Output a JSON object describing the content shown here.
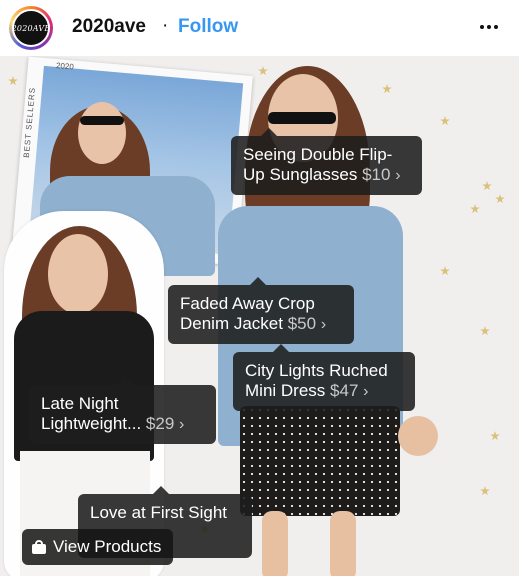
{
  "header": {
    "avatar_text": "2020AVE",
    "username": "2020ave",
    "separator": "·",
    "follow_label": "Follow",
    "more_icon": "more-horizontal-icon"
  },
  "photo": {
    "polaroid_side_text": "BEST SELLERS",
    "polaroid_year": "2020"
  },
  "tags": [
    {
      "name_line1": "Seeing Double Flip-",
      "name_line2": "Up Sunglasses",
      "price": "$10",
      "chevron": "›"
    },
    {
      "name_line1": "Faded Away Crop",
      "name_line2": "Denim Jacket",
      "price": "$50",
      "chevron": "›"
    },
    {
      "name_line1": "City Lights Ruched",
      "name_line2": "Mini Dress",
      "price": "$47",
      "chevron": "›"
    },
    {
      "name_line1": "Late Night",
      "name_line2": "Lightweight...",
      "price": "$29",
      "chevron": "›"
    },
    {
      "name_line1": "Love at First Sight",
      "name_line2": "",
      "price": "",
      "chevron": ""
    }
  ],
  "view_products": {
    "icon": "shopping-bag-icon",
    "label": "View Products"
  }
}
